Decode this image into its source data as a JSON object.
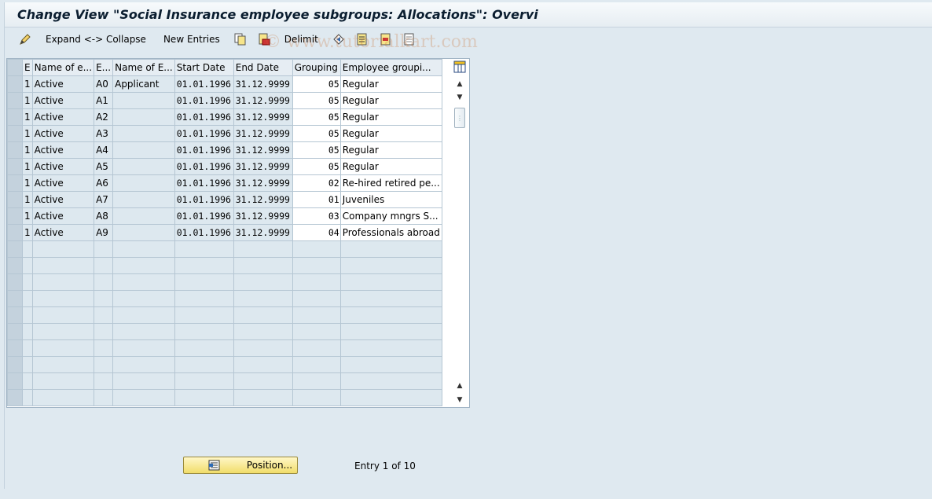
{
  "window": {
    "title": "Change View \"Social Insurance employee subgroups: Allocations\": Overvi"
  },
  "toolbar": {
    "expand_collapse_label": "Expand <-> Collapse",
    "new_entries_label": "New Entries",
    "delimit_label": "Delimit"
  },
  "watermark": "© www.tutorialkart.com",
  "table": {
    "columns": [
      "E",
      "Name of e...",
      "E...",
      "Name of E...",
      "Start Date",
      "End Date",
      "Grouping",
      "Employee groupi..."
    ],
    "rows": [
      [
        "1",
        "Active",
        "A0",
        "Applicant",
        "01.01.1996",
        "31.12.9999",
        "05",
        "Regular"
      ],
      [
        "1",
        "Active",
        "A1",
        "",
        "01.01.1996",
        "31.12.9999",
        "05",
        "Regular"
      ],
      [
        "1",
        "Active",
        "A2",
        "",
        "01.01.1996",
        "31.12.9999",
        "05",
        "Regular"
      ],
      [
        "1",
        "Active",
        "A3",
        "",
        "01.01.1996",
        "31.12.9999",
        "05",
        "Regular"
      ],
      [
        "1",
        "Active",
        "A4",
        "",
        "01.01.1996",
        "31.12.9999",
        "05",
        "Regular"
      ],
      [
        "1",
        "Active",
        "A5",
        "",
        "01.01.1996",
        "31.12.9999",
        "05",
        "Regular"
      ],
      [
        "1",
        "Active",
        "A6",
        "",
        "01.01.1996",
        "31.12.9999",
        "02",
        "Re-hired retired pe..."
      ],
      [
        "1",
        "Active",
        "A7",
        "",
        "01.01.1996",
        "31.12.9999",
        "01",
        "Juveniles"
      ],
      [
        "1",
        "Active",
        "A8",
        "",
        "01.01.1996",
        "31.12.9999",
        "03",
        "Company mngrs S..."
      ],
      [
        "1",
        "Active",
        "A9",
        "",
        "01.01.1996",
        "31.12.9999",
        "04",
        "Professionals abroad"
      ]
    ],
    "empty_rows": 10
  },
  "footer": {
    "position_label": "Position...",
    "entry_text": "Entry 1 of 10"
  },
  "colors": {
    "background": "#dfe9f0",
    "button_yellow": "#f1dd6a",
    "header_bg": "#e6edf3"
  }
}
